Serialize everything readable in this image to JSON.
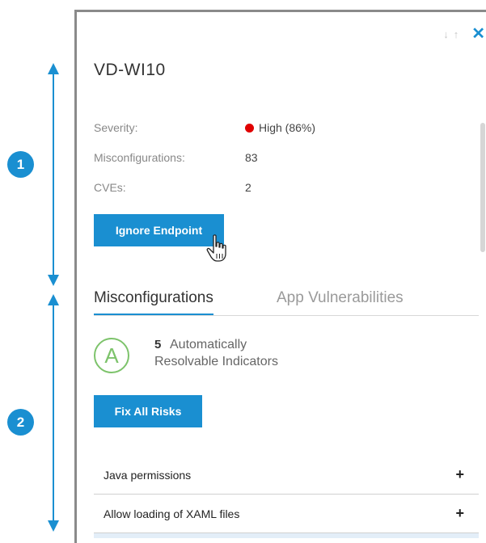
{
  "annotations": {
    "callout_1": "1",
    "callout_2": "2"
  },
  "panel": {
    "sort_icon": "sort-arrows-icon",
    "sort_text": "↓↑",
    "close_text": "✕",
    "host_name": "VD-WI10",
    "severity_label": "Severity:",
    "severity_value": "High (86%)",
    "severity_color": "#e00000",
    "misconfig_label": "Misconfigurations:",
    "misconfig_value": "83",
    "cves_label": "CVEs:",
    "cves_value": "2",
    "ignore_button": "Ignore Endpoint"
  },
  "tabs": [
    {
      "label": "Misconfigurations",
      "active": true
    },
    {
      "label": "App Vulnerabilities",
      "active": false
    }
  ],
  "auto_resolve": {
    "badge": "A",
    "count": "5",
    "label_line1": "Automatically",
    "label_line2": "Resolvable Indicators"
  },
  "fix_button": "Fix All Risks",
  "risks": [
    {
      "label": "Java permissions",
      "action": "+"
    },
    {
      "label": "Allow loading of XAML files",
      "action": "+"
    }
  ],
  "colors": {
    "accent": "#1a8fd1",
    "badge_green": "#7dc36b"
  }
}
